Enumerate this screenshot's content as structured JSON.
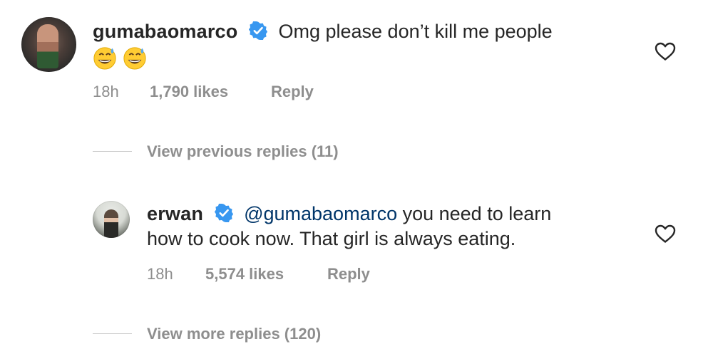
{
  "comment": {
    "username": "gumabaomarco",
    "text": "Omg please don’t kill me people",
    "emojis": [
      "grinning-face-with-sweat-icon",
      "grinning-face-with-sweat-icon"
    ],
    "time": "18h",
    "likes": "1,790 likes",
    "reply_label": "Reply"
  },
  "view_previous": "View previous replies (11)",
  "reply": {
    "username": "erwan",
    "mention": "@gumabaomarco",
    "text_line1": " you need to learn",
    "text_line2": "how to cook now. That girl is always eating.",
    "time": "18h",
    "likes": "5,574 likes",
    "reply_label": "Reply"
  },
  "view_more": "View more replies (120)",
  "colors": {
    "verified": "#3897f0",
    "meta_text": "#8e8e8e",
    "mention": "#003569"
  }
}
